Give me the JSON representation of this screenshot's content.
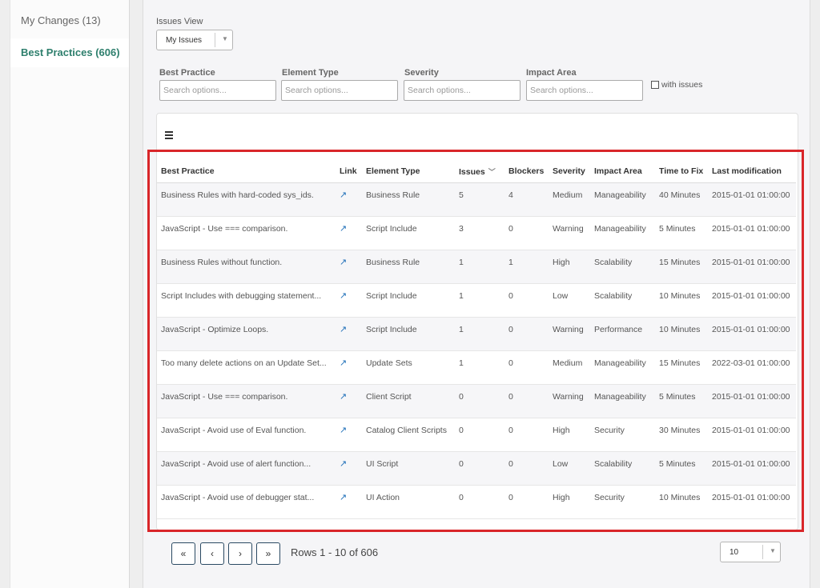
{
  "sidebar": {
    "items": [
      {
        "label": "My Changes (13)"
      },
      {
        "label": "Best Practices (606)"
      }
    ]
  },
  "issues_view": {
    "label": "Issues View",
    "selected": "My Issues"
  },
  "filters": {
    "best_practice_label": "Best Practice",
    "element_type_label": "Element Type",
    "severity_label": "Severity",
    "impact_area_label": "Impact Area",
    "placeholder": "Search options...",
    "with_issues_label": "with issues"
  },
  "table": {
    "columns": [
      "Best Practice",
      "Link",
      "Element Type",
      "Issues",
      "Blockers",
      "Severity",
      "Impact Area",
      "Time to Fix",
      "Last modification"
    ],
    "rows": [
      {
        "best_practice": "Business Rules with hard-coded sys_ids.",
        "element_type": "Business Rule",
        "issues": "5",
        "blockers": "4",
        "severity": "Medium",
        "impact_area": "Manageability",
        "time_to_fix": "40 Minutes",
        "last_modification": "2015-01-01 01:00:00"
      },
      {
        "best_practice": "JavaScript - Use === comparison.",
        "element_type": "Script Include",
        "issues": "3",
        "blockers": "0",
        "severity": "Warning",
        "impact_area": "Manageability",
        "time_to_fix": "5 Minutes",
        "last_modification": "2015-01-01 01:00:00"
      },
      {
        "best_practice": "Business Rules without function.",
        "element_type": "Business Rule",
        "issues": "1",
        "blockers": "1",
        "severity": "High",
        "impact_area": "Scalability",
        "time_to_fix": "15 Minutes",
        "last_modification": "2015-01-01 01:00:00"
      },
      {
        "best_practice": "Script Includes with debugging statement...",
        "element_type": "Script Include",
        "issues": "1",
        "blockers": "0",
        "severity": "Low",
        "impact_area": "Scalability",
        "time_to_fix": "10 Minutes",
        "last_modification": "2015-01-01 01:00:00"
      },
      {
        "best_practice": "JavaScript - Optimize Loops.",
        "element_type": "Script Include",
        "issues": "1",
        "blockers": "0",
        "severity": "Warning",
        "impact_area": "Performance",
        "time_to_fix": "10 Minutes",
        "last_modification": "2015-01-01 01:00:00"
      },
      {
        "best_practice": "Too many delete actions on an Update Set...",
        "element_type": "Update Sets",
        "issues": "1",
        "blockers": "0",
        "severity": "Medium",
        "impact_area": "Manageability",
        "time_to_fix": "15 Minutes",
        "last_modification": "2022-03-01 01:00:00"
      },
      {
        "best_practice": "JavaScript - Use === comparison.",
        "element_type": "Client Script",
        "issues": "0",
        "blockers": "0",
        "severity": "Warning",
        "impact_area": "Manageability",
        "time_to_fix": "5 Minutes",
        "last_modification": "2015-01-01 01:00:00"
      },
      {
        "best_practice": "JavaScript - Avoid use of Eval function.",
        "element_type": "Catalog Client Scripts",
        "issues": "0",
        "blockers": "0",
        "severity": "High",
        "impact_area": "Security",
        "time_to_fix": "30 Minutes",
        "last_modification": "2015-01-01 01:00:00"
      },
      {
        "best_practice": "JavaScript - Avoid use of alert function...",
        "element_type": "UI Script",
        "issues": "0",
        "blockers": "0",
        "severity": "Low",
        "impact_area": "Scalability",
        "time_to_fix": "5 Minutes",
        "last_modification": "2015-01-01 01:00:00"
      },
      {
        "best_practice": "JavaScript -  Avoid use of debugger stat...",
        "element_type": "UI Action",
        "issues": "0",
        "blockers": "0",
        "severity": "High",
        "impact_area": "Security",
        "time_to_fix": "10 Minutes",
        "last_modification": "2015-01-01 01:00:00"
      }
    ]
  },
  "pager": {
    "first": "«",
    "prev": "‹",
    "next": "›",
    "last": "»",
    "rows_info": "Rows 1 - 10 of 606",
    "page_size": "10"
  },
  "colors": {
    "accent": "#2e7f6d",
    "highlight": "#d9262a",
    "link": "#1f6fb8"
  },
  "icons": {
    "link": "external-link-icon",
    "menu": "hamburger-menu-icon",
    "sort": "chevron-down-icon"
  }
}
